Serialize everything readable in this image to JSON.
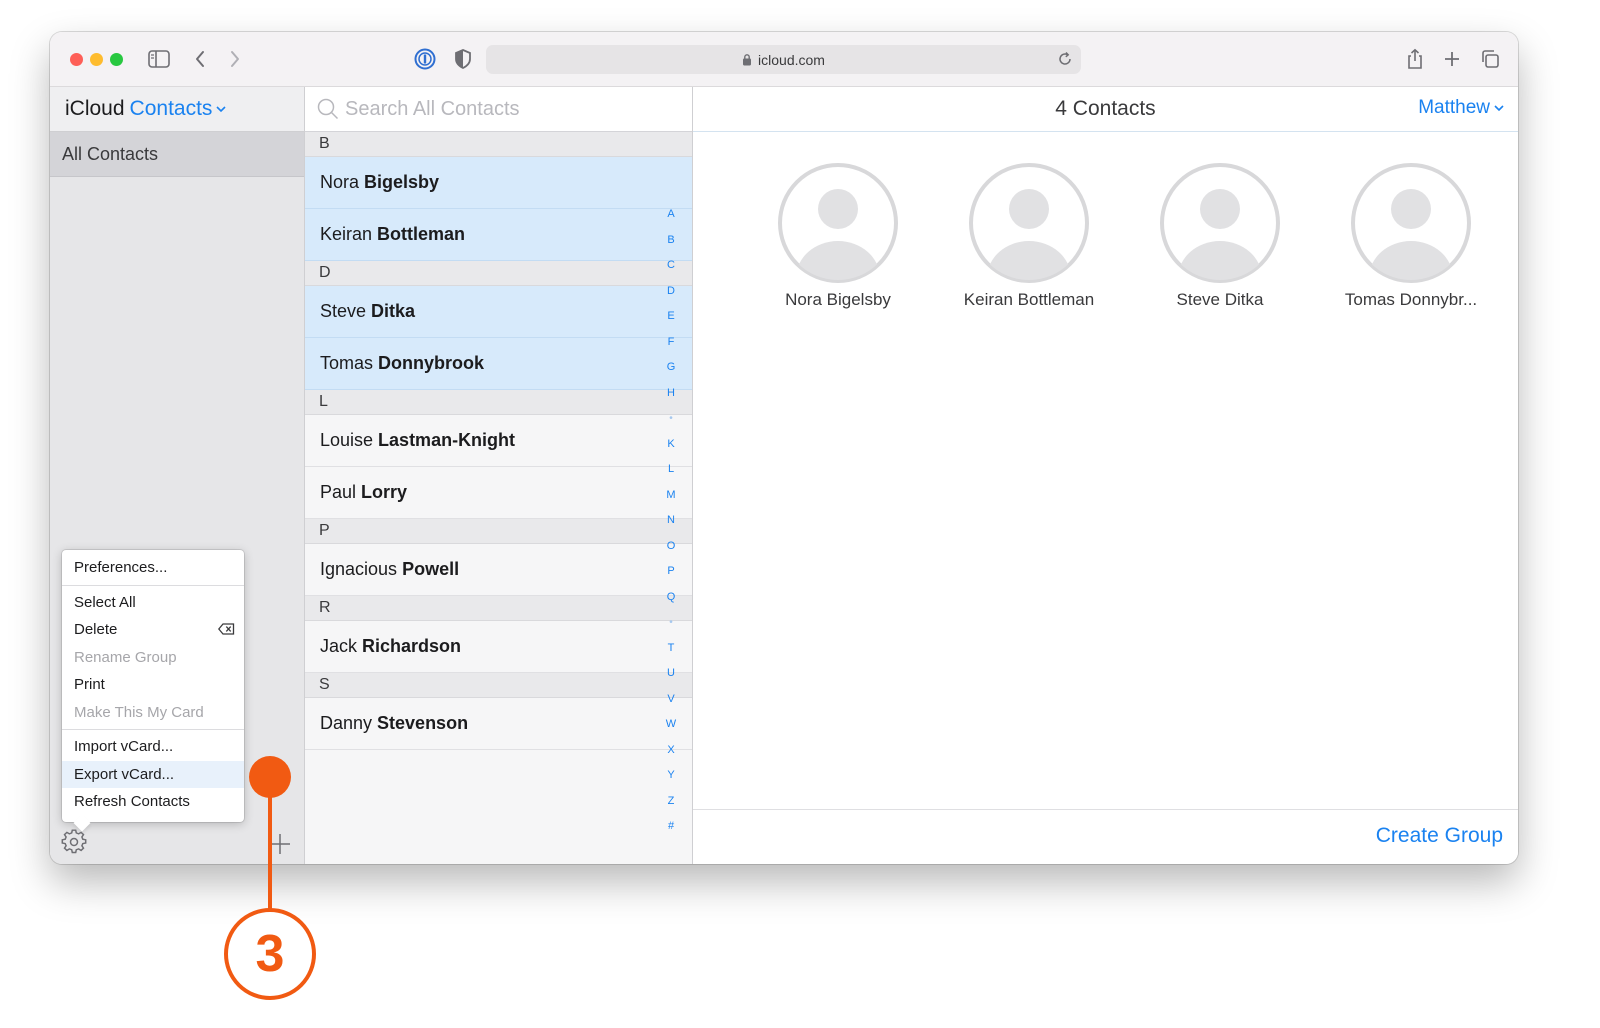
{
  "browser": {
    "url": "icloud.com"
  },
  "sidebar": {
    "brand": "iCloud",
    "app_name": "Contacts",
    "groups": [
      {
        "label": "All Contacts"
      }
    ]
  },
  "menu": {
    "items": [
      {
        "label": "Preferences...",
        "enabled": true
      },
      {
        "label": "Select All",
        "enabled": true
      },
      {
        "label": "Delete",
        "enabled": true
      },
      {
        "label": "Rename Group",
        "enabled": false
      },
      {
        "label": "Print",
        "enabled": true
      },
      {
        "label": "Make This My Card",
        "enabled": false
      },
      {
        "label": "Import vCard...",
        "enabled": true
      },
      {
        "label": "Export vCard...",
        "enabled": true,
        "highlighted": true
      },
      {
        "label": "Refresh Contacts",
        "enabled": true
      }
    ]
  },
  "list": {
    "search_placeholder": "Search All Contacts",
    "sections": [
      {
        "letter": "B",
        "contacts": [
          {
            "first": "Nora",
            "last": "Bigelsby",
            "selected": true
          },
          {
            "first": "Keiran",
            "last": "Bottleman",
            "selected": true
          }
        ]
      },
      {
        "letter": "D",
        "contacts": [
          {
            "first": "Steve",
            "last": "Ditka",
            "selected": true
          },
          {
            "first": "Tomas",
            "last": "Donnybrook",
            "selected": true
          }
        ]
      },
      {
        "letter": "L",
        "contacts": [
          {
            "first": "Louise",
            "last": "Lastman-Knight",
            "selected": false
          },
          {
            "first": "Paul",
            "last": "Lorry",
            "selected": false
          }
        ]
      },
      {
        "letter": "P",
        "contacts": [
          {
            "first": "Ignacious",
            "last": "Powell",
            "selected": false
          }
        ]
      },
      {
        "letter": "R",
        "contacts": [
          {
            "first": "Jack",
            "last": "Richardson",
            "selected": false
          }
        ]
      },
      {
        "letter": "S",
        "contacts": [
          {
            "first": "Danny",
            "last": "Stevenson",
            "selected": false
          }
        ]
      }
    ],
    "index": [
      "A",
      "B",
      "C",
      "D",
      "E",
      "F",
      "G",
      "H",
      "•",
      "K",
      "L",
      "M",
      "N",
      "O",
      "P",
      "Q",
      "•",
      "T",
      "U",
      "V",
      "W",
      "X",
      "Y",
      "Z",
      "#"
    ]
  },
  "detail": {
    "title": "4 Contacts",
    "user": "Matthew",
    "cards": [
      {
        "name": "Nora Bigelsby"
      },
      {
        "name": "Keiran Bottleman"
      },
      {
        "name": "Steve Ditka"
      },
      {
        "name": "Tomas Donnybr..."
      }
    ],
    "create_group": "Create Group"
  },
  "callout": {
    "number": "3"
  },
  "colors": {
    "accent": "#1a82f0",
    "callout": "#f15a12",
    "selection": "#d7eafb"
  }
}
